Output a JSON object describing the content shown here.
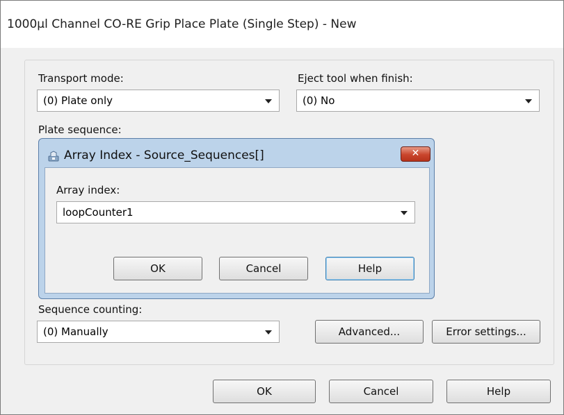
{
  "window": {
    "title": "1000µl Channel CO-RE Grip Place Plate (Single Step) - New"
  },
  "form": {
    "transport_mode_label": "Transport mode:",
    "transport_mode_value": "(0) Plate only",
    "eject_tool_label": "Eject tool when finish:",
    "eject_tool_value": "(0) No",
    "plate_sequence_label": "Plate sequence:",
    "sequence_counting_label": "Sequence counting:",
    "sequence_counting_value": "(0) Manually",
    "advanced_label": "Advanced...",
    "error_settings_label": "Error settings..."
  },
  "dialog": {
    "title": "Array Index - Source_Sequences[]",
    "close_glyph": "✕",
    "array_index_label": "Array index:",
    "array_index_value": "loopCounter1",
    "ok_label": "OK",
    "cancel_label": "Cancel",
    "help_label": "Help",
    "icon": "array-index-icon"
  },
  "footer": {
    "ok_label": "OK",
    "cancel_label": "Cancel",
    "help_label": "Help"
  }
}
